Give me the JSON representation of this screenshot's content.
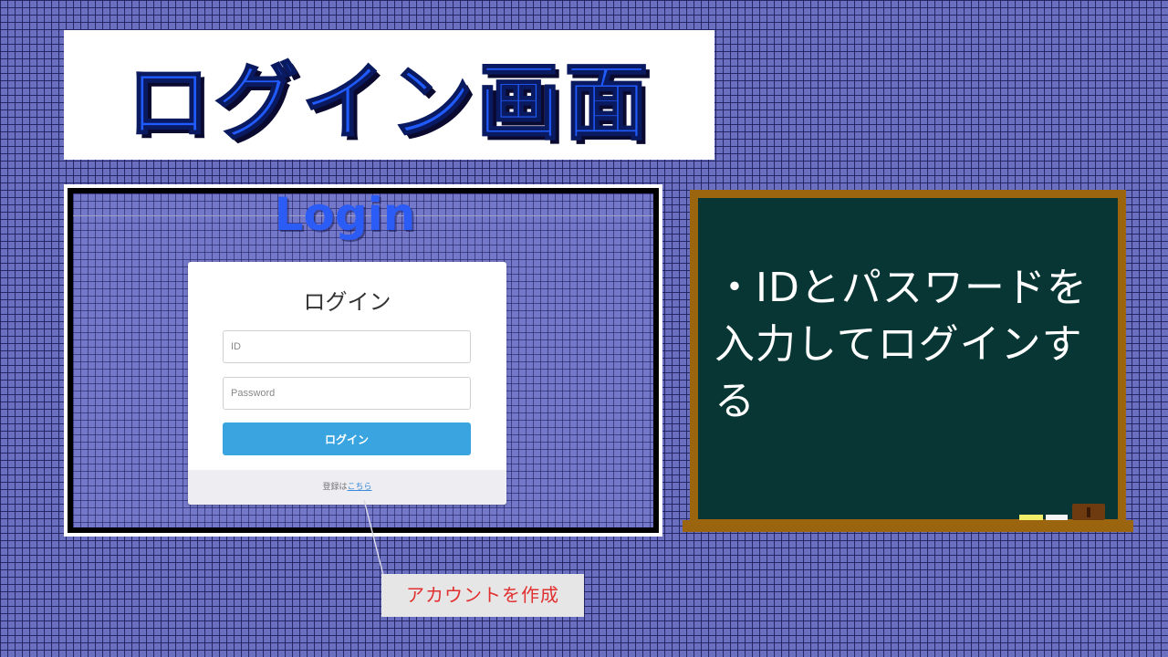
{
  "slide": {
    "title": "ログイン画面"
  },
  "screenshot": {
    "heading": "Login",
    "login_form": {
      "title": "ログイン",
      "id_placeholder": "ID",
      "password_placeholder": "Password",
      "submit_label": "ログイン",
      "register_prefix": "登録は",
      "register_link": "こちら"
    }
  },
  "callout": {
    "text": "アカウントを作成"
  },
  "blackboard": {
    "text": "・IDとパスワードを入力してログインする"
  },
  "colors": {
    "title_blue": "#1f5bff",
    "button_blue": "#3aa4e0",
    "board_green": "#073634",
    "board_frame": "#9b6510",
    "callout_red": "#e03030"
  }
}
